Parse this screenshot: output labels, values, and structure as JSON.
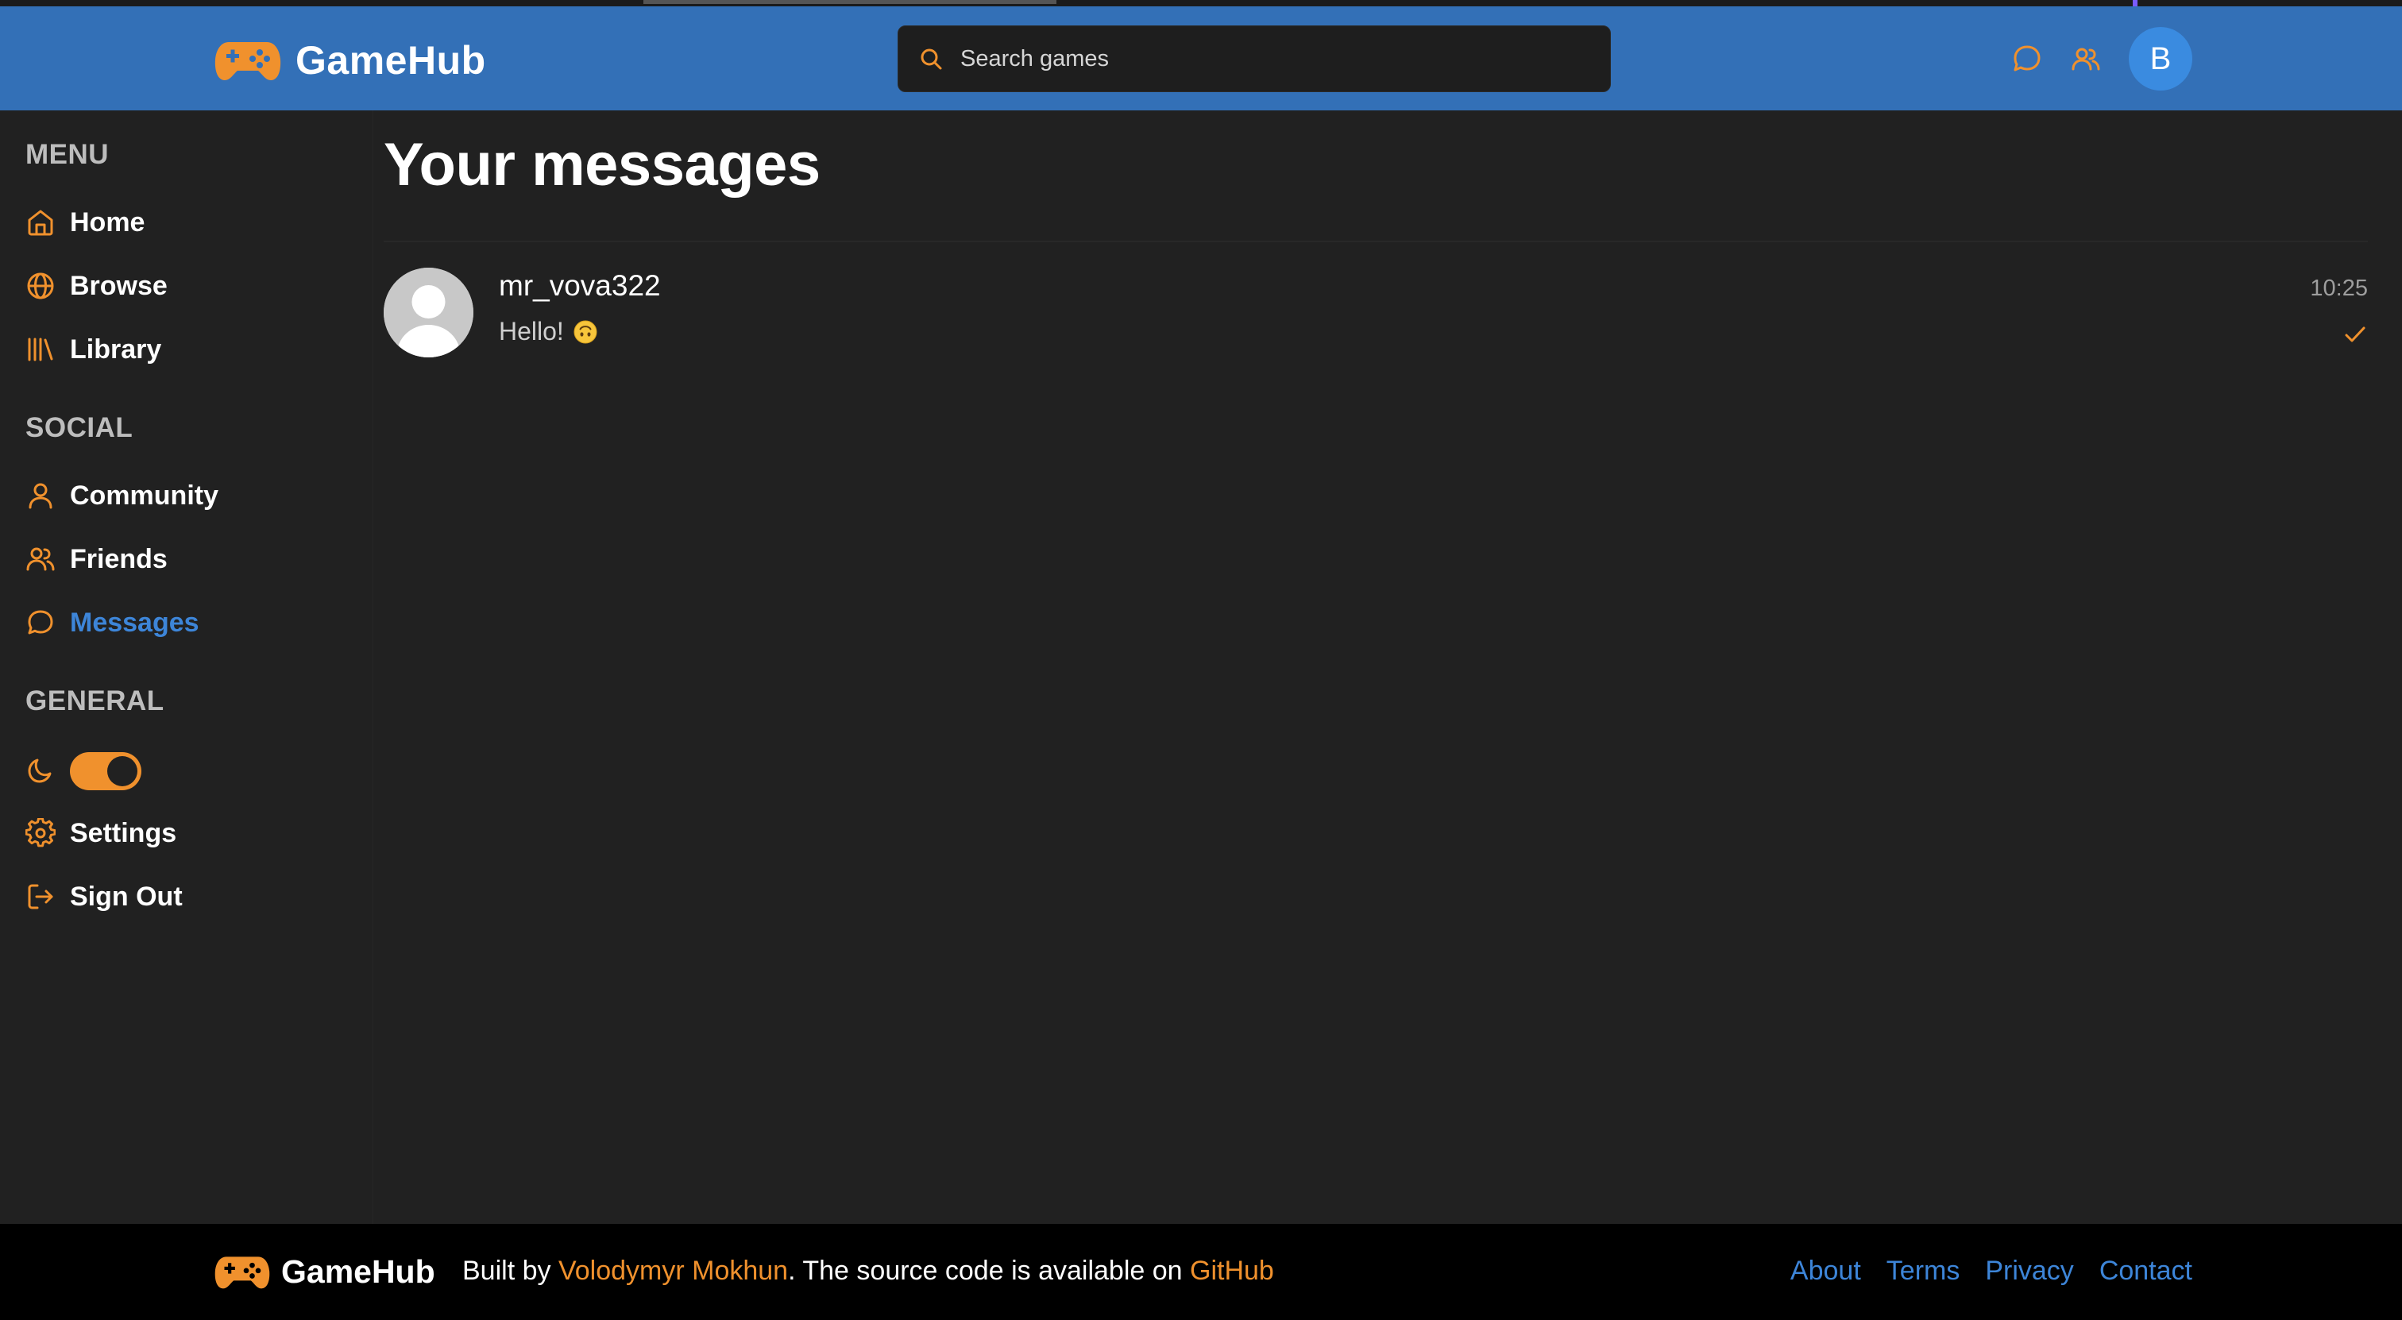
{
  "colors": {
    "header_bg": "#3370b7",
    "accent_orange": "#f0912d",
    "accent_blue": "#3d85d8",
    "page_bg": "#212121",
    "footer_bg": "#000000"
  },
  "header": {
    "brand": "GameHub",
    "search_placeholder": "Search games",
    "icons": [
      "messages-icon",
      "friends-icon"
    ],
    "avatar_letter": "B"
  },
  "sidebar": {
    "sections": [
      {
        "title": "MENU",
        "items": [
          {
            "label": "Home",
            "icon": "home-icon"
          },
          {
            "label": "Browse",
            "icon": "globe-icon"
          },
          {
            "label": "Library",
            "icon": "library-icon"
          }
        ]
      },
      {
        "title": "SOCIAL",
        "items": [
          {
            "label": "Community",
            "icon": "user-icon"
          },
          {
            "label": "Friends",
            "icon": "users-icon"
          },
          {
            "label": "Messages",
            "icon": "message-icon",
            "active": true
          }
        ]
      },
      {
        "title": "GENERAL",
        "items": [
          {
            "label": "",
            "icon": "moon-icon",
            "toggle": "on"
          },
          {
            "label": "Settings",
            "icon": "gear-icon"
          },
          {
            "label": "Sign Out",
            "icon": "sign-out-icon"
          }
        ]
      }
    ]
  },
  "main": {
    "title": "Your messages",
    "conversations": [
      {
        "name": "mr_vova322",
        "preview": "Hello!",
        "preview_emoji": "upside-down-face-emoji",
        "time": "10:25",
        "status": "read"
      }
    ]
  },
  "footer": {
    "brand": "GameHub",
    "credit_prefix": "Built by ",
    "author": "Volodymyr Mokhun",
    "credit_middle": ". The source code is available on ",
    "source_link": "GitHub",
    "links": [
      "About",
      "Terms",
      "Privacy",
      "Contact"
    ]
  }
}
